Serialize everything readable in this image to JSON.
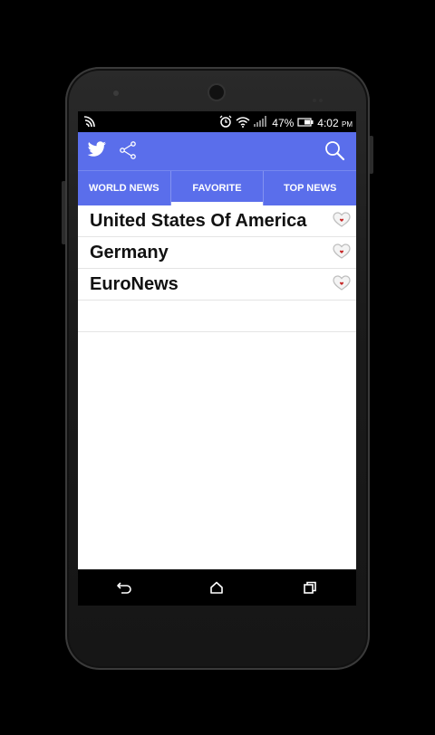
{
  "status_bar": {
    "battery_percent": "47%",
    "time": "4:02",
    "ampm": "PM",
    "icons": [
      "wifi-signal-icon",
      "alarm-icon",
      "wifi-icon",
      "cell-signal-icon",
      "battery-icon"
    ]
  },
  "app_bar": {
    "icons": [
      "twitter-icon",
      "share-icon",
      "search-icon"
    ],
    "accent_color": "#5a6eeb"
  },
  "tabs": [
    {
      "label": "WORLD NEWS",
      "active": false
    },
    {
      "label": "FAVORITE",
      "active": true
    },
    {
      "label": "TOP NEWS",
      "active": false
    }
  ],
  "favorites": [
    {
      "label": "United States Of America",
      "icon": "heart-icon"
    },
    {
      "label": "Germany",
      "icon": "heart-icon"
    },
    {
      "label": "EuroNews",
      "icon": "heart-icon"
    }
  ],
  "nav_bar": {
    "icons": [
      "back-icon",
      "home-icon",
      "recents-icon"
    ]
  }
}
